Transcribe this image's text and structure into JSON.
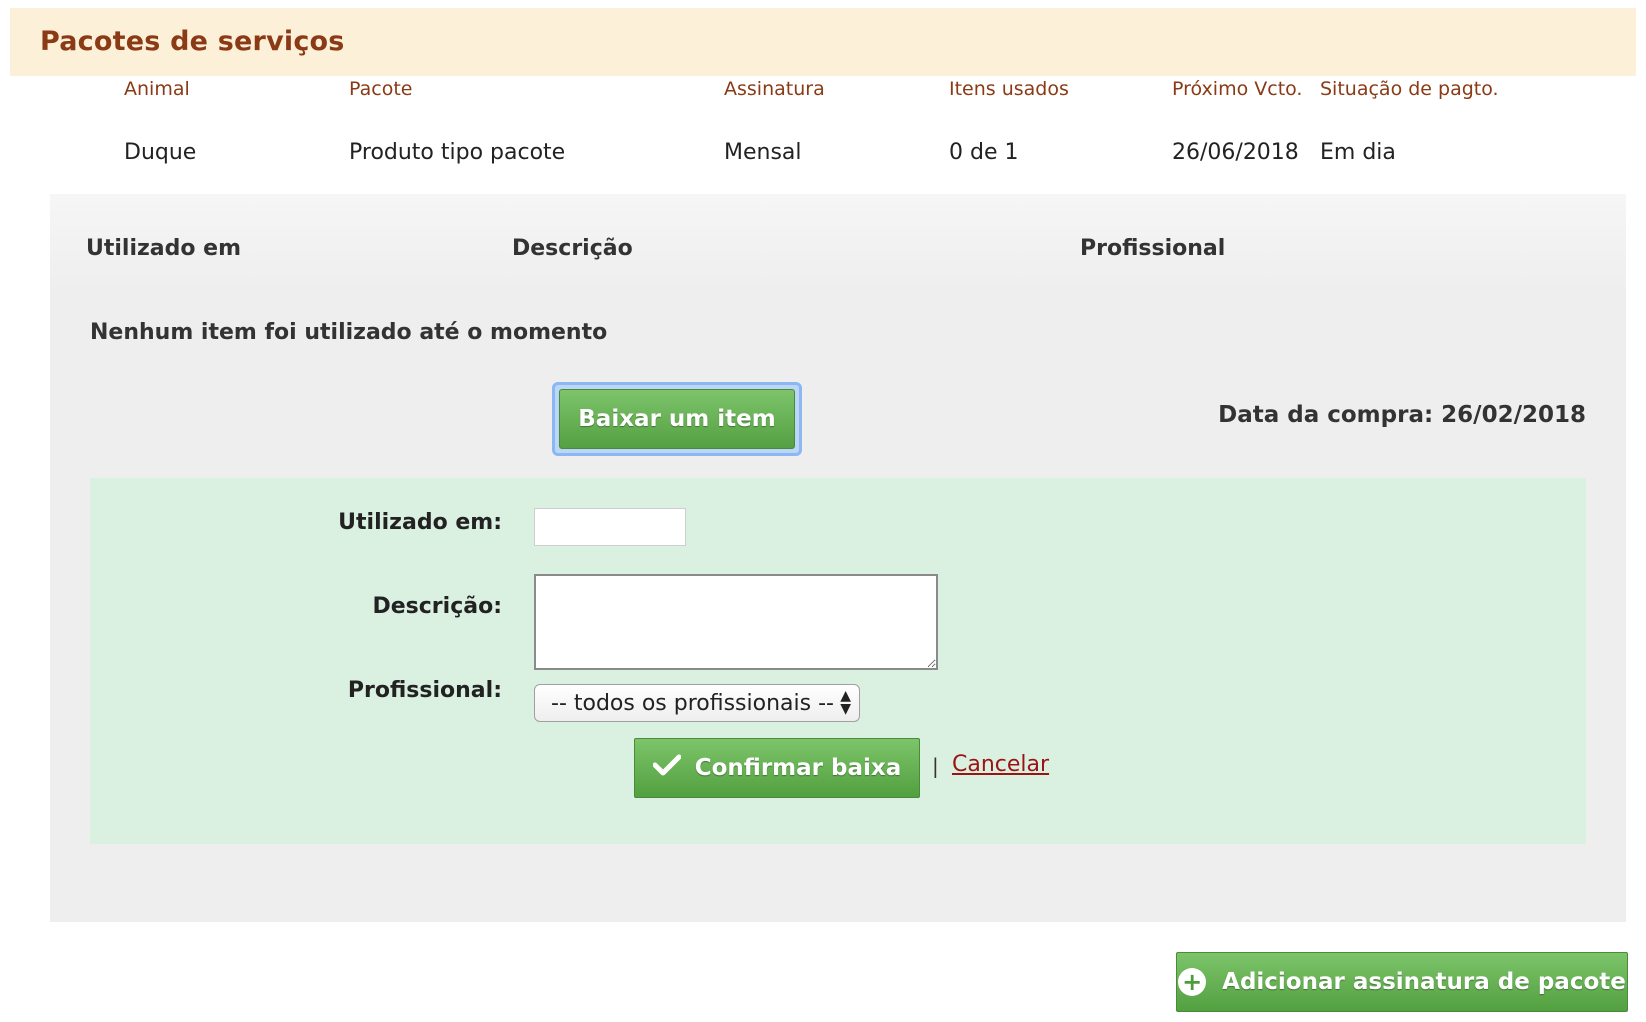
{
  "header": {
    "title": "Pacotes de serviços"
  },
  "table": {
    "columns": [
      "Animal",
      "Pacote",
      "Assinatura",
      "Itens usados",
      "Próximo Vcto.",
      "Situação de pagto."
    ],
    "row": [
      "Duque",
      "Produto tipo pacote",
      "Mensal",
      "0 de 1",
      "26/06/2018",
      "Em dia"
    ]
  },
  "usage": {
    "columns": [
      "Utilizado em",
      "Descrição",
      "Profissional"
    ],
    "empty_message": "Nenhum item foi utilizado até o momento",
    "baixar_label": "Baixar um item",
    "purchase_date": "Data da compra: 26/02/2018"
  },
  "form": {
    "utilizado_label": "Utilizado em:",
    "utilizado_value": "",
    "descricao_label": "Descrição:",
    "descricao_value": "",
    "profissional_label": "Profissional:",
    "profissional_selected": "-- todos os profissionais --",
    "confirm_label": "Confirmar baixa",
    "separator": "|",
    "cancel_label": "Cancelar"
  },
  "footer": {
    "add_label": "Adicionar assinatura de pacote"
  },
  "colors": {
    "accent": "#8a3a15",
    "green": "#5aa547",
    "header_bg": "#fdf0d8",
    "form_bg": "#daf0e1",
    "link": "#9b1414"
  },
  "icons": {
    "confirm": "check-icon",
    "add": "plus-circle-icon",
    "select": "select-arrows-icon"
  }
}
